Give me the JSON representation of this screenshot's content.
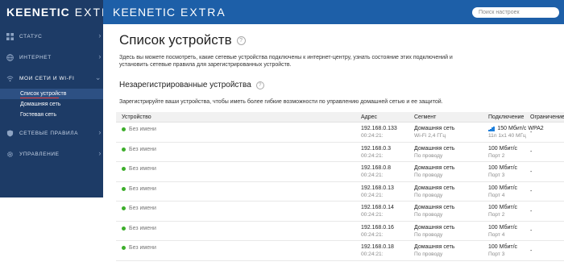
{
  "sidebar": {
    "logo_brand": "KEENETIC",
    "logo_model": "EXTRA",
    "items": [
      {
        "label": "СТАТУС",
        "icon": "dashboard-icon"
      },
      {
        "label": "ИНТЕРНЕТ",
        "icon": "globe-icon"
      },
      {
        "label": "МОИ СЕТИ И WI-FI",
        "icon": "wifi-icon"
      },
      {
        "label": "СЕТЕВЫЕ ПРАВИЛА",
        "icon": "shield-icon"
      },
      {
        "label": "УПРАВЛЕНИЕ",
        "icon": "gear-icon"
      }
    ],
    "subitems": [
      "Список устройств",
      "Домашняя сеть",
      "Гостевая сеть"
    ]
  },
  "topbar": {
    "brand": "KEENETIC",
    "model": "EXTRA",
    "search_placeholder": "Поиск настроек"
  },
  "page": {
    "title": "Список устройств",
    "intro": "Здесь вы можете посмотреть, какие сетевые устройства подключены к интернет-центру, узнать состояние этих подключений и установить сетевые правила для зарегистрированных устройств.",
    "section_title": "Незарегистрированные устройства",
    "section_note": "Зарегистрируйте ваши устройства, чтобы иметь более гибкие возможности по управлению домашней сетью и ее защитой."
  },
  "table": {
    "headers": [
      "Устройство",
      "Адрес",
      "Сегмент",
      "Подключение",
      "Ограничение"
    ],
    "rows": [
      {
        "name": "Без имени",
        "ip": "192.168.0.133",
        "mac": "00:24:21:",
        "segment": "Домашняя сеть",
        "segment_sub": "Wi-Fi 2,4 ГГц",
        "conn": "150 Мбит/с WPA2",
        "conn_sub": "11n 1x1 40 МГц",
        "limit": "-",
        "wifi": true
      },
      {
        "name": "Без имени",
        "ip": "192.168.0.3",
        "mac": "00:24:21:",
        "segment": "Домашняя сеть",
        "segment_sub": "По проводу",
        "conn": "100 Мбит/с",
        "conn_sub": "Порт 2",
        "limit": "-",
        "wifi": false
      },
      {
        "name": "Без имени",
        "ip": "192.168.0.8",
        "mac": "00:24:21:",
        "segment": "Домашняя сеть",
        "segment_sub": "По проводу",
        "conn": "100 Мбит/с",
        "conn_sub": "Порт 3",
        "limit": "-",
        "wifi": false
      },
      {
        "name": "Без имени",
        "ip": "192.168.0.13",
        "mac": "00:24:21:",
        "segment": "Домашняя сеть",
        "segment_sub": "По проводу",
        "conn": "100 Мбит/с",
        "conn_sub": "Порт 4",
        "limit": "-",
        "wifi": false
      },
      {
        "name": "Без имени",
        "ip": "192.168.0.14",
        "mac": "00:24:21:",
        "segment": "Домашняя сеть",
        "segment_sub": "По проводу",
        "conn": "100 Мбит/с",
        "conn_sub": "Порт 2",
        "limit": "-",
        "wifi": false
      },
      {
        "name": "Без имени",
        "ip": "192.168.0.16",
        "mac": "00:24:21:",
        "segment": "Домашняя сеть",
        "segment_sub": "По проводу",
        "conn": "100 Мбит/с",
        "conn_sub": "Порт 4",
        "limit": "-",
        "wifi": false
      },
      {
        "name": "Без имени",
        "ip": "192.168.0.18",
        "mac": "00:24:21:",
        "segment": "Домашняя сеть",
        "segment_sub": "По проводу",
        "conn": "100 Мбит/с",
        "conn_sub": "Порт 3",
        "limit": "-",
        "wifi": false
      }
    ]
  },
  "colors": {
    "sidebar_bg": "#1d3b66",
    "topbar_bg": "#1d5fa8",
    "online_dot": "#3dae2b",
    "active_underline": "#e53935",
    "wifi_signal": "#1d7fdc"
  }
}
